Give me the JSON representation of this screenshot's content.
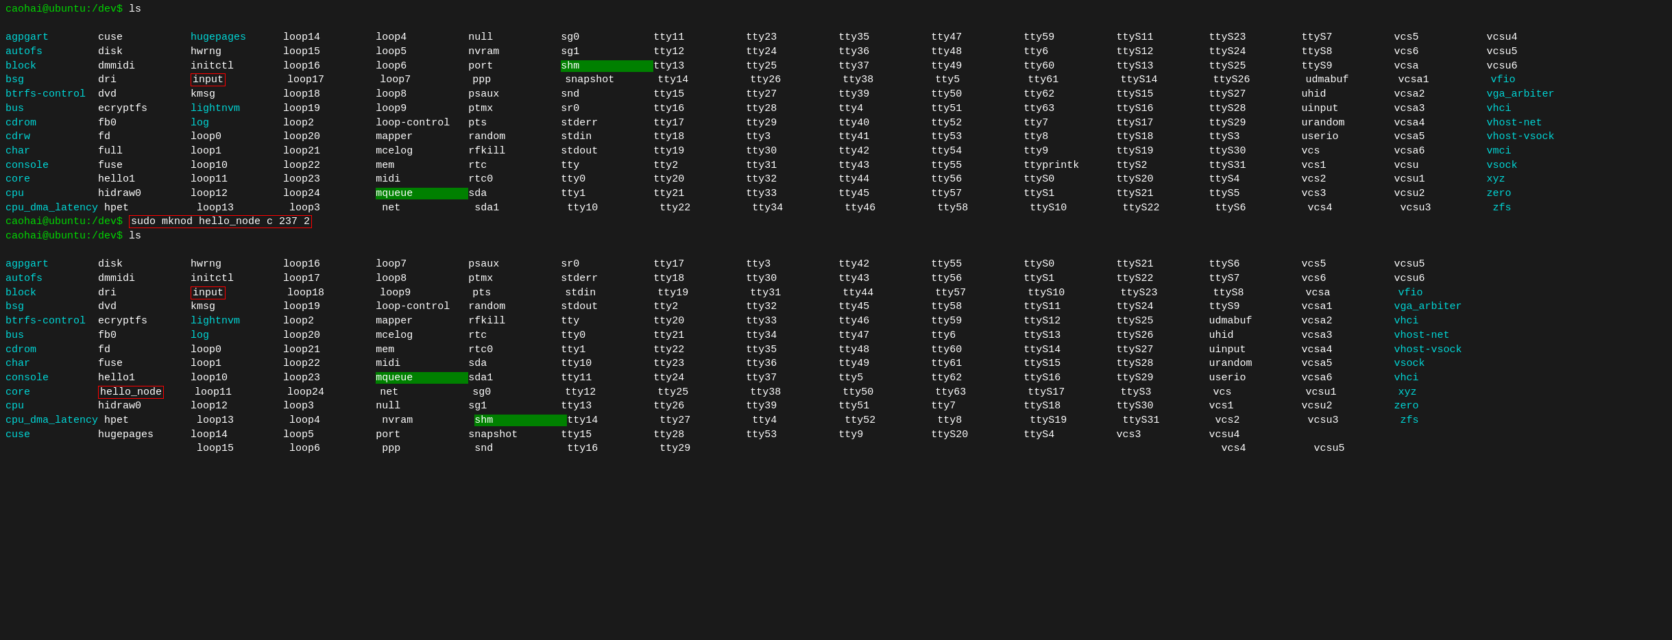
{
  "terminal": {
    "bg": "#1a1a1a",
    "prompt_color": "#00ff00",
    "default_color": "#c0c0c0",
    "cmd_color": "#ffffff",
    "prompt1": "caohai@ubuntu:/dev$ ls",
    "cmd1": "sudo mknod hello_node c 237 2",
    "prompt2": "caohai@ubuntu:/dev$ ls",
    "highlighted_items": [
      "shm",
      "mqueue"
    ],
    "boxed_items": [
      "input",
      "mqueue"
    ],
    "second_boxed_items": [
      "input",
      "mqueue",
      "hello_node"
    ]
  }
}
